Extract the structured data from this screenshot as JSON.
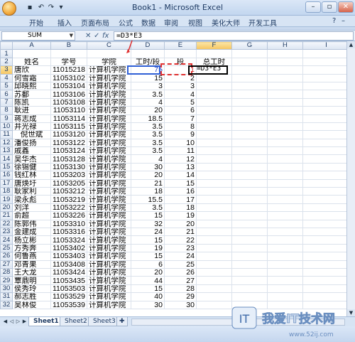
{
  "window": {
    "title": "Book1 - Microsoft Excel"
  },
  "ribbon_tabs": [
    "开始",
    "插入",
    "页面布局",
    "公式",
    "数据",
    "审阅",
    "视图",
    "美化大师",
    "开发工具"
  ],
  "formula_bar": {
    "name_box": "SUM",
    "cancel_icon": "✕",
    "enter_icon": "✓",
    "fx": "fx",
    "formula": "=D3*E3"
  },
  "columns": [
    "A",
    "B",
    "C",
    "D",
    "E",
    "F",
    "G",
    "H",
    "I"
  ],
  "header_row": {
    "row": "2",
    "cells": [
      "姓名",
      "学号",
      "学院",
      "工时/段",
      "段",
      "总工时",
      "",
      "",
      ""
    ]
  },
  "rows": [
    {
      "row": "1",
      "cells": [
        "",
        "",
        "",
        "",
        "",
        "",
        "",
        "",
        ""
      ]
    },
    {
      "row": "3",
      "cells": [
        "唐欣",
        "11015218",
        "计算机学院",
        "75",
        "1",
        "=D3*E3",
        "",
        "",
        ""
      ]
    },
    {
      "row": "4",
      "cells": [
        "何雪霜",
        "11053102",
        "计算机学院",
        "15",
        "2",
        "",
        "",
        "",
        ""
      ]
    },
    {
      "row": "5",
      "cells": [
        "邱晓熙",
        "11053104",
        "计算机学院",
        "3",
        "3",
        "",
        "",
        "",
        ""
      ]
    },
    {
      "row": "6",
      "cells": [
        "苏鄱",
        "11053106",
        "计算机学院",
        "3.5",
        "4",
        "",
        "",
        "",
        ""
      ]
    },
    {
      "row": "7",
      "cells": [
        "陈凯",
        "11053108",
        "计算机学院",
        "4",
        "5",
        "",
        "",
        "",
        ""
      ]
    },
    {
      "row": "8",
      "cells": [
        "耿进",
        "11053110",
        "计算机学院",
        "20",
        "6",
        "",
        "",
        "",
        ""
      ]
    },
    {
      "row": "9",
      "cells": [
        "蒋志成",
        "11053114",
        "计算机学院",
        "18.5",
        "7",
        "",
        "",
        "",
        ""
      ]
    },
    {
      "row": "10",
      "cells": [
        "井光禄",
        "11053115",
        "计算机学院",
        "3.5",
        "8",
        "",
        "",
        "",
        ""
      ]
    },
    {
      "row": "11",
      "cells": [
        "倪世斌",
        "11053120",
        "计算机学院",
        "3.5",
        "9",
        "",
        "",
        "",
        ""
      ]
    },
    {
      "row": "12",
      "cells": [
        "潘俊扬",
        "11053122",
        "计算机学院",
        "3.5",
        "10",
        "",
        "",
        "",
        ""
      ]
    },
    {
      "row": "13",
      "cells": [
        "戚鑫",
        "11053124",
        "计算机学院",
        "3.5",
        "11",
        "",
        "",
        "",
        ""
      ]
    },
    {
      "row": "14",
      "cells": [
        "吴华杰",
        "11053128",
        "计算机学院",
        "4",
        "12",
        "",
        "",
        "",
        ""
      ]
    },
    {
      "row": "15",
      "cells": [
        "徐锡健",
        "11053130",
        "计算机学院",
        "30",
        "13",
        "",
        "",
        "",
        ""
      ]
    },
    {
      "row": "16",
      "cells": [
        "钱红林",
        "11053203",
        "计算机学院",
        "20",
        "14",
        "",
        "",
        "",
        ""
      ]
    },
    {
      "row": "17",
      "cells": [
        "唐焕圩",
        "11053205",
        "计算机学院",
        "21",
        "15",
        "",
        "",
        "",
        ""
      ]
    },
    {
      "row": "18",
      "cells": [
        "耿家利",
        "11053212",
        "计算机学院",
        "18",
        "16",
        "",
        "",
        "",
        ""
      ]
    },
    {
      "row": "19",
      "cells": [
        "梁永彪",
        "11053219",
        "计算机学院",
        "15.5",
        "17",
        "",
        "",
        "",
        ""
      ]
    },
    {
      "row": "20",
      "cells": [
        "刘洋",
        "11053222",
        "计算机学院",
        "3.5",
        "18",
        "",
        "",
        "",
        ""
      ]
    },
    {
      "row": "21",
      "cells": [
        "俞超",
        "11053226",
        "计算机学院",
        "15",
        "19",
        "",
        "",
        "",
        ""
      ]
    },
    {
      "row": "22",
      "cells": [
        "陈郭伟",
        "11053310",
        "计算机学院",
        "32",
        "20",
        "",
        "",
        "",
        ""
      ]
    },
    {
      "row": "23",
      "cells": [
        "金建成",
        "11053316",
        "计算机学院",
        "24",
        "21",
        "",
        "",
        "",
        ""
      ]
    },
    {
      "row": "24",
      "cells": [
        "杨立彬",
        "11053324",
        "计算机学院",
        "15",
        "22",
        "",
        "",
        "",
        ""
      ]
    },
    {
      "row": "25",
      "cells": [
        "方秀奔",
        "11053402",
        "计算机学院",
        "19",
        "23",
        "",
        "",
        "",
        ""
      ]
    },
    {
      "row": "26",
      "cells": [
        "何鲁燕",
        "11053403",
        "计算机学院",
        "15",
        "24",
        "",
        "",
        "",
        ""
      ]
    },
    {
      "row": "27",
      "cells": [
        "邓青果",
        "11053408",
        "计算机学院",
        "6",
        "25",
        "",
        "",
        "",
        ""
      ]
    },
    {
      "row": "28",
      "cells": [
        "王大龙",
        "11053424",
        "计算机学院",
        "20",
        "26",
        "",
        "",
        "",
        ""
      ]
    },
    {
      "row": "29",
      "cells": [
        "覃鼎明",
        "11053435",
        "计算机学院",
        "44",
        "27",
        "",
        "",
        "",
        ""
      ]
    },
    {
      "row": "30",
      "cells": [
        "侯秀玲",
        "11053503",
        "计算机学院",
        "15",
        "28",
        "",
        "",
        "",
        ""
      ]
    },
    {
      "row": "31",
      "cells": [
        "郝志胜",
        "11053529",
        "计算机学院",
        "40",
        "29",
        "",
        "",
        "",
        ""
      ]
    },
    {
      "row": "32",
      "cells": [
        "吴林俊",
        "11053539",
        "计算机学院",
        "30",
        "30",
        "",
        "",
        "",
        ""
      ]
    }
  ],
  "sheet_tabs": [
    "Sheet1",
    "Sheet2",
    "Sheet3"
  ],
  "watermark": {
    "text": "我爱IT技术网",
    "url": "www.52ij.com"
  },
  "colors": {
    "accent": "#2f5fd6",
    "highlight": "#e03030"
  }
}
